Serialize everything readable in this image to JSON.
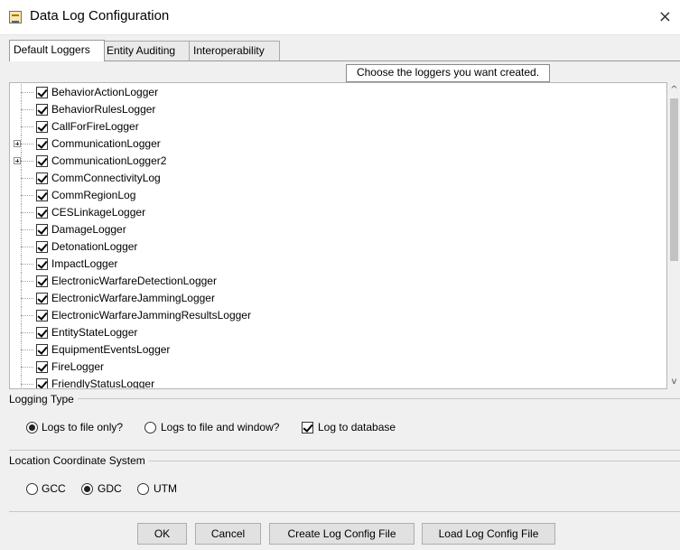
{
  "window": {
    "title": "Data Log Configuration",
    "close_glyph": "×"
  },
  "tabs": [
    {
      "label": "Default Loggers",
      "active": true
    },
    {
      "label": "Entity Auditing",
      "active": false
    },
    {
      "label": "Interoperability",
      "active": false
    }
  ],
  "hint": "Choose the loggers you want created.",
  "loggers": [
    {
      "label": "BehaviorActionLogger",
      "checked": true,
      "expandable": false
    },
    {
      "label": "BehaviorRulesLogger",
      "checked": true,
      "expandable": false
    },
    {
      "label": "CallForFireLogger",
      "checked": true,
      "expandable": false
    },
    {
      "label": "CommunicationLogger",
      "checked": true,
      "expandable": true
    },
    {
      "label": "CommunicationLogger2",
      "checked": true,
      "expandable": true
    },
    {
      "label": "CommConnectivityLog",
      "checked": true,
      "expandable": false
    },
    {
      "label": "CommRegionLog",
      "checked": true,
      "expandable": false
    },
    {
      "label": "CESLinkageLogger",
      "checked": true,
      "expandable": false
    },
    {
      "label": "DamageLogger",
      "checked": true,
      "expandable": false
    },
    {
      "label": "DetonationLogger",
      "checked": true,
      "expandable": false
    },
    {
      "label": "ImpactLogger",
      "checked": true,
      "expandable": false
    },
    {
      "label": "ElectronicWarfareDetectionLogger",
      "checked": true,
      "expandable": false
    },
    {
      "label": "ElectronicWarfareJammingLogger",
      "checked": true,
      "expandable": false
    },
    {
      "label": "ElectronicWarfareJammingResultsLogger",
      "checked": true,
      "expandable": false
    },
    {
      "label": "EntityStateLogger",
      "checked": true,
      "expandable": false
    },
    {
      "label": "EquipmentEventsLogger",
      "checked": true,
      "expandable": false
    },
    {
      "label": "FireLogger",
      "checked": true,
      "expandable": false
    },
    {
      "label": "FriendlyStatusLogger",
      "checked": true,
      "expandable": false
    }
  ],
  "scroll": {
    "up_glyph": "^",
    "down_glyph": "v"
  },
  "logging_type": {
    "title": "Logging Type",
    "file_only": "Logs to file only?",
    "file_and_window": "Logs to file and window?",
    "database": "Log to database",
    "selected": "file_only",
    "database_checked": true
  },
  "coordinate_system": {
    "title": "Location Coordinate System",
    "options": [
      "GCC",
      "GDC",
      "UTM"
    ],
    "selected": "GDC"
  },
  "buttons": {
    "ok": "OK",
    "cancel": "Cancel",
    "create": "Create Log Config File",
    "load": "Load Log Config File"
  }
}
